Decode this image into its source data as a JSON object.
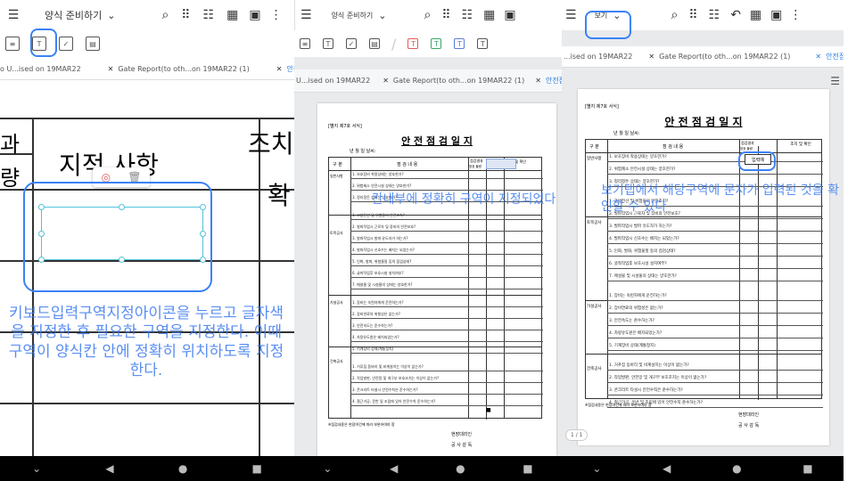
{
  "panel1": {
    "top": {
      "menu_icon": "menu-icon",
      "title": "양식 준비하기",
      "caret": "⌄"
    },
    "tabs": [
      "o U...ised on 19MAR22",
      "Gate Report(to oth...on 19MAR22 (1)",
      "안전점검일지"
    ],
    "doc_fragments": {
      "top_left": "과",
      "top_right": "조치",
      "mid": "지적 사항",
      "left_bottom": "량",
      "right_bottom": "확"
    },
    "caption": "키보드입력구역지정아이콘을 누르고 글자색을 지정한 후 필요한 구역을 지정한다. 이때 구역이 양식칸 안에 정확히 위치하도록 지정한다."
  },
  "panel2": {
    "top": {
      "title": "양식 준비하기",
      "caret": "⌄"
    },
    "tabs": [
      "U...ised on 19MAR22",
      "Gate Report(to oth...on 19MAR22 (1)",
      "안전점"
    ],
    "caption": "칸내부에 정확히 구역이 지정되었다",
    "doc": {
      "form_no": "[별지 제7호 서식]",
      "title": "안 전 점 검 일 지",
      "date_row": "년      월      일      날씨:",
      "col_section": "구 분",
      "col_items": "점 검 내 용",
      "col_result": "점검결과",
      "col_result_sub": "양호  불량",
      "col_action": "조치 및 확인",
      "sections": [
        "일반사항",
        "토목공사",
        "가설공사",
        "건축공사"
      ],
      "footer": "※점검내용은 현장여건에 따라 보완하여야 함",
      "sign1": "현장대리인",
      "sign2": "공 사 감 독",
      "mark": "■"
    }
  },
  "panel3": {
    "top": {
      "view_label": "보기",
      "caret": "⌄"
    },
    "tabs": [
      "...ised on 19MAR22",
      "Gate Report(to oth...on 19MAR22 (1)",
      "안전점검일지"
    ],
    "caption": "보기탭에서 해당구역에 문자가 입력된 것을 확인할 수 있다",
    "input_badge": "입력예",
    "page_indicator": "1 / 1",
    "doc": {
      "form_no": "[별지 제7호 서식]",
      "title": "안 전 점 검 일 지",
      "date_row": "년      월      일      날씨:",
      "col_section": "구 분",
      "col_items": "점 검 내 용",
      "col_result": "점검결과",
      "col_result_sub": "양호  불량",
      "col_action": "조치 및 확인",
      "sections": [
        "일반사항",
        "토목공사",
        "가설공사",
        "건축공사"
      ],
      "items": [
        "1. 보호장비 착용상태는 양호한가?",
        "2. 위험제소 안전시설 상태는 양호한가?",
        "3. 정리정돈 상태는 양호한가?",
        "1. 고압전선 및 위험물의 안전조치?",
        "2. 발파작업시 근로자 및 장비의 안전보호?",
        "3. 발파작업시 발파 유도자가 하는가?",
        "4. 발파작업시 신호수는 배치는 되었는가?",
        "5. 인화, 발화, 위험물질 등의 점검상태?",
        "6. 굴착작업후 보호시설 설치여부?",
        "7. 매설물 및 시설물의 상태는 양호한가?",
        "1. 장비는 숙련자에게 운전하는가?",
        "2. 장비연료의 위험성은 없는가?",
        "3. 안전속도는 준수하는가?",
        "4. 차량유도원은 배치되었는가?",
        "5. 기계장비 상태(계통정지)",
        "1. 거푸집 동바리 및 비계설치는 이상이 없는가?",
        "2. 작업발판, 안전망 및 개구부 보호조치는 이상이 없는가?",
        "3. 콘크리트 타설시 안전수칙은 준수하는가?",
        "4. 철근가공, 운반 및 조립에 있어 안전수칙 준수하는가?"
      ],
      "footer": "※점검내용은 현장여건에 따라 보완하여야 함",
      "sign1": "현장대리인",
      "sign2": "공 사 감 독"
    }
  },
  "icons": {
    "search": "search-icon",
    "grid": "grid-icon",
    "list": "list-icon",
    "apps": "apps-icon",
    "doc": "document-icon",
    "more": "more-icon"
  },
  "colors": {
    "highlight": "#3b82f6",
    "caption": "#3d7bf0",
    "selection": "#56c1d8"
  }
}
